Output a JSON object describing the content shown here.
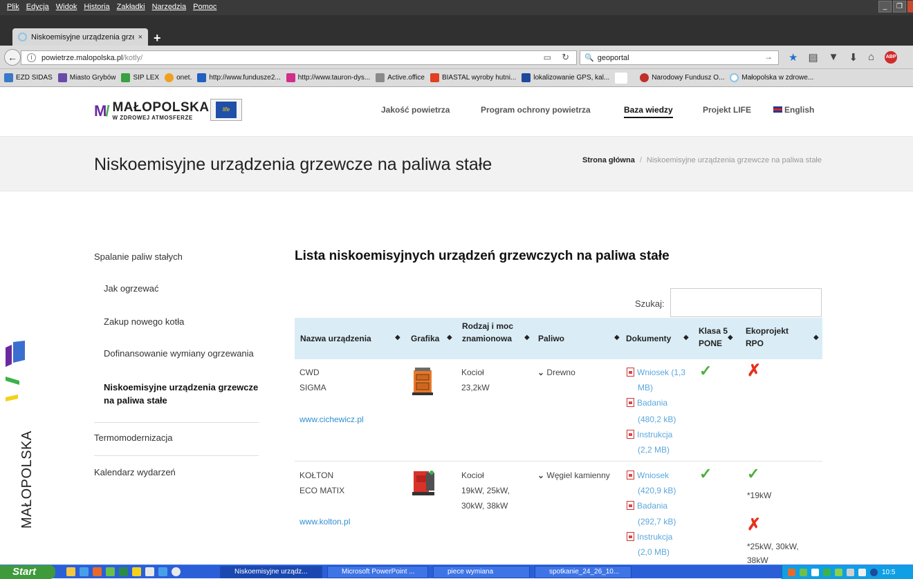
{
  "browser": {
    "menu": [
      "Plik",
      "Edycja",
      "Widok",
      "Historia",
      "Zakładki",
      "Narzędzia",
      "Pomoc"
    ],
    "tab_title": "Niskoemisyjne urządzenia grze...",
    "tab_close": "×",
    "new_tab": "+",
    "url_host": "powietrze.malopolska.pl",
    "url_path": "/kotly/",
    "search_value": "geoportal",
    "bookmarks": [
      {
        "label": "EZD SIDAS",
        "color": "#3a78c8"
      },
      {
        "label": "Miasto Grybów",
        "color": "#6a4aa8"
      },
      {
        "label": "SIP LEX",
        "color": "#3aa040"
      },
      {
        "label": "onet.",
        "color": "#f0a020"
      },
      {
        "label": "http://www.fundusze2...",
        "color": "#2060c0"
      },
      {
        "label": "http://www.tauron-dys...",
        "color": "#d0308a"
      },
      {
        "label": "Active.office",
        "color": "#8a8a8a"
      },
      {
        "label": "BIASTAL wyroby hutni...",
        "color": "#e04020"
      },
      {
        "label": "lokalizowanie GPS, kal...",
        "color": "#1e4a9a"
      },
      {
        "label": "",
        "color": "#ffffff"
      },
      {
        "label": "Narodowy Fundusz O...",
        "color": "#c0302a"
      },
      {
        "label": "Małopolska w zdrowe...",
        "color": "#8cc4e8"
      }
    ]
  },
  "site": {
    "logo_line1": "MAŁOPOLSKA",
    "logo_line2": "W ZDROWEJ ATMOSFERZE",
    "eu_badge": "life",
    "nav": [
      "Jakość powietrza",
      "Program ochrony powietrza",
      "Baza wiedzy",
      "Projekt LIFE",
      "English"
    ],
    "page_title": "Niskoemisyjne urządzenia grzewcze na paliwa stałe",
    "breadcrumb_home": "Strona główna",
    "breadcrumb_sep": "/",
    "breadcrumb_current": "Niskoemisyjne urządzenia grzewcze na paliwa stałe",
    "vertical_brand": "MAŁOPOLSKA"
  },
  "sidebar": {
    "items": [
      "Spalanie paliw stałych",
      "Jak ogrzewać",
      "Zakup nowego kotła",
      "Dofinansowanie wymiany ogrzewania",
      "Niskoemisyjne urządzenia grzewcze na paliwa stałe",
      "Termomodernizacja",
      "Kalendarz wydarzeń"
    ]
  },
  "main": {
    "list_title": "Lista niskoemisyjnych urządzeń grzewczych na paliwa stałe",
    "search_label": "Szukaj:",
    "search_value": "",
    "columns": [
      "Nazwa urządzenia",
      "Grafika",
      "Rodzaj i moc znamionowa",
      "Paliwo",
      "Dokumenty",
      "Klasa 5 PONE",
      "Ekoprojekt RPO"
    ],
    "rows": [
      {
        "maker": "CWD",
        "model": "SIGMA",
        "url": "www.cichewicz.pl",
        "type": "Kocioł",
        "power": "23,2kW",
        "fuel": "Drewno",
        "docs": [
          {
            "label": "Wniosek (1,3",
            "label2": "MB)"
          },
          {
            "label": "Badania",
            "label2": "(480,2 kB)"
          },
          {
            "label": "Instrukcja",
            "label2": "(2,2 MB)"
          }
        ],
        "klasa5": "check",
        "ekoprojekt": "cross",
        "ekoprojekt_note": ""
      },
      {
        "maker": "KOŁTON",
        "model": "ECO MATIX",
        "url": "www.kolton.pl",
        "type": "Kocioł",
        "power1": "19kW, 25kW,",
        "power2": "30kW, 38kW",
        "fuel": "Węgiel kamienny",
        "docs": [
          {
            "label": "Wniosek",
            "label2": "(420,9 kB)"
          },
          {
            "label": "Badania",
            "label2": "(292,7 kB)"
          },
          {
            "label": "Instrukcja",
            "label2": "(2,0 MB)"
          }
        ],
        "klasa5": "check",
        "ekoprojekt": "check",
        "ekoprojekt_note": "*19kW",
        "ekoprojekt2": "cross",
        "ekoprojekt_note2": "*25kW, 30kW,",
        "ekoprojekt_note3": "38kW"
      }
    ]
  },
  "taskbar": {
    "start": "Start",
    "tasks": [
      "Niskoemisyjne urządz...",
      "Microsoft PowerPoint ...",
      "piece wymiana",
      "spotkanie_24_26_10..."
    ],
    "clock": "10:5"
  }
}
